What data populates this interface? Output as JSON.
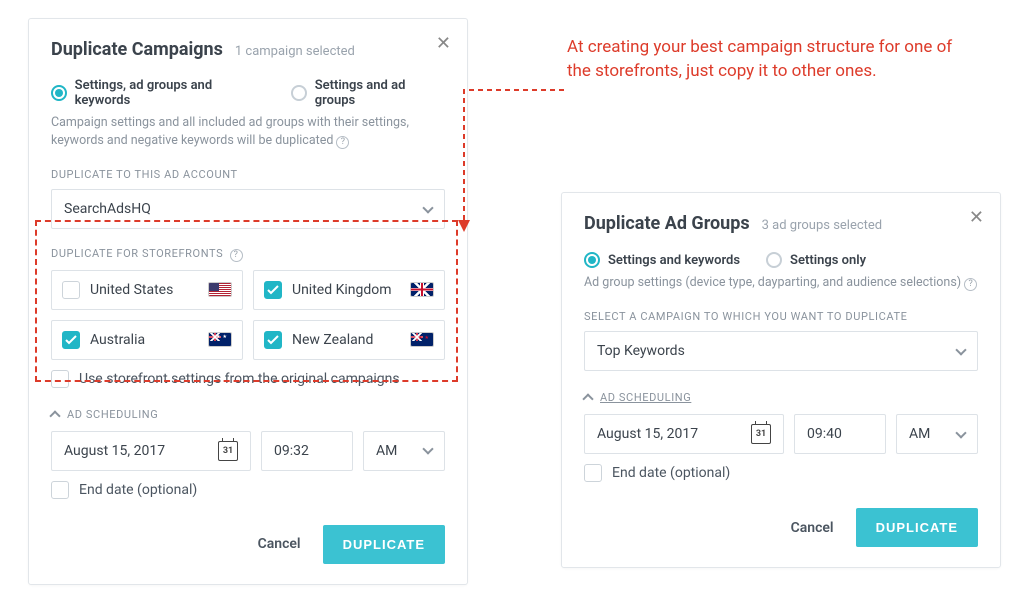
{
  "callout": "At creating your best campaign structure for one of the storefronts,  just copy it to other ones.",
  "left": {
    "title": "Duplicate Campaigns",
    "subtitle": "1 campaign selected",
    "option1": "Settings, ad groups and keywords",
    "option2": "Settings and ad groups",
    "help": "Campaign settings and all included ad groups with their settings, keywords and negative keywords will be duplicated",
    "account_label": "DUPLICATE TO THIS AD ACCOUNT",
    "account_value": "SearchAdsHQ",
    "storefront_label": "DUPLICATE FOR STOREFRONTS",
    "storefronts": [
      {
        "name": "United States",
        "checked": false,
        "flag": "us"
      },
      {
        "name": "United Kingdom",
        "checked": true,
        "flag": "uk"
      },
      {
        "name": "Australia",
        "checked": true,
        "flag": "au"
      },
      {
        "name": "New Zealand",
        "checked": true,
        "flag": "nz"
      }
    ],
    "use_original": "Use storefront settings from the original campaigns",
    "scheduling": "AD SCHEDULING",
    "date": "August 15, 2017",
    "day": "31",
    "time": "09:32",
    "ampm": "AM",
    "end_date": "End date (optional)",
    "cancel": "Cancel",
    "duplicate": "DUPLICATE"
  },
  "right": {
    "title": "Duplicate Ad Groups",
    "subtitle": "3 ad groups selected",
    "option1": "Settings and keywords",
    "option2": "Settings only",
    "help": "Ad group settings (device type, dayparting, and audience selections)",
    "campaign_label": "SELECT A CAMPAIGN TO WHICH YOU WANT TO DUPLICATE",
    "campaign_value": "Top Keywords",
    "scheduling": "AD SCHEDULING",
    "date": "August 15, 2017",
    "day": "31",
    "time": "09:40",
    "ampm": "AM",
    "end_date": "End date (optional)",
    "cancel": "Cancel",
    "duplicate": "DUPLICATE"
  }
}
